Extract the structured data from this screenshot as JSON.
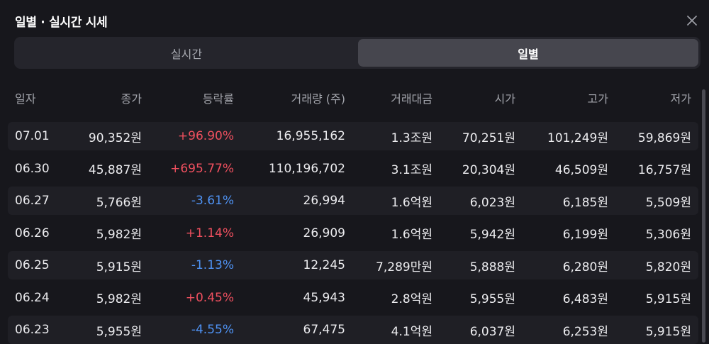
{
  "header": {
    "title": "일별 · 실시간 시세",
    "close_icon": "close-icon"
  },
  "tabs": [
    {
      "label": "실시간",
      "active": false
    },
    {
      "label": "일별",
      "active": true
    }
  ],
  "table": {
    "columns": [
      "일자",
      "종가",
      "등락률",
      "거래량 (주)",
      "거래대금",
      "시가",
      "고가",
      "저가"
    ],
    "rows": [
      {
        "date": "07.01",
        "close": "90,352원",
        "change": "+96.90%",
        "direction": "up",
        "volume": "16,955,162",
        "amount": "1.3조원",
        "open": "70,251원",
        "high": "101,249원",
        "low": "59,869원"
      },
      {
        "date": "06.30",
        "close": "45,887원",
        "change": "+695.77%",
        "direction": "up",
        "volume": "110,196,702",
        "amount": "3.1조원",
        "open": "20,304원",
        "high": "46,509원",
        "low": "16,757원"
      },
      {
        "date": "06.27",
        "close": "5,766원",
        "change": "-3.61%",
        "direction": "down",
        "volume": "26,994",
        "amount": "1.6억원",
        "open": "6,023원",
        "high": "6,185원",
        "low": "5,509원"
      },
      {
        "date": "06.26",
        "close": "5,982원",
        "change": "+1.14%",
        "direction": "up",
        "volume": "26,909",
        "amount": "1.6억원",
        "open": "5,942원",
        "high": "6,199원",
        "low": "5,306원"
      },
      {
        "date": "06.25",
        "close": "5,915원",
        "change": "-1.13%",
        "direction": "down",
        "volume": "12,245",
        "amount": "7,289만원",
        "open": "5,888원",
        "high": "6,280원",
        "low": "5,820원"
      },
      {
        "date": "06.24",
        "close": "5,982원",
        "change": "+0.45%",
        "direction": "up",
        "volume": "45,943",
        "amount": "2.8억원",
        "open": "5,955원",
        "high": "6,483원",
        "low": "5,915원"
      },
      {
        "date": "06.23",
        "close": "5,955원",
        "change": "-4.55%",
        "direction": "down",
        "volume": "67,475",
        "amount": "4.1억원",
        "open": "6,037원",
        "high": "6,253원",
        "low": "5,915원"
      }
    ]
  },
  "colors": {
    "up": "#f0505f",
    "down": "#4f93f5",
    "background": "#17171c",
    "active_tab": "#46464e"
  }
}
